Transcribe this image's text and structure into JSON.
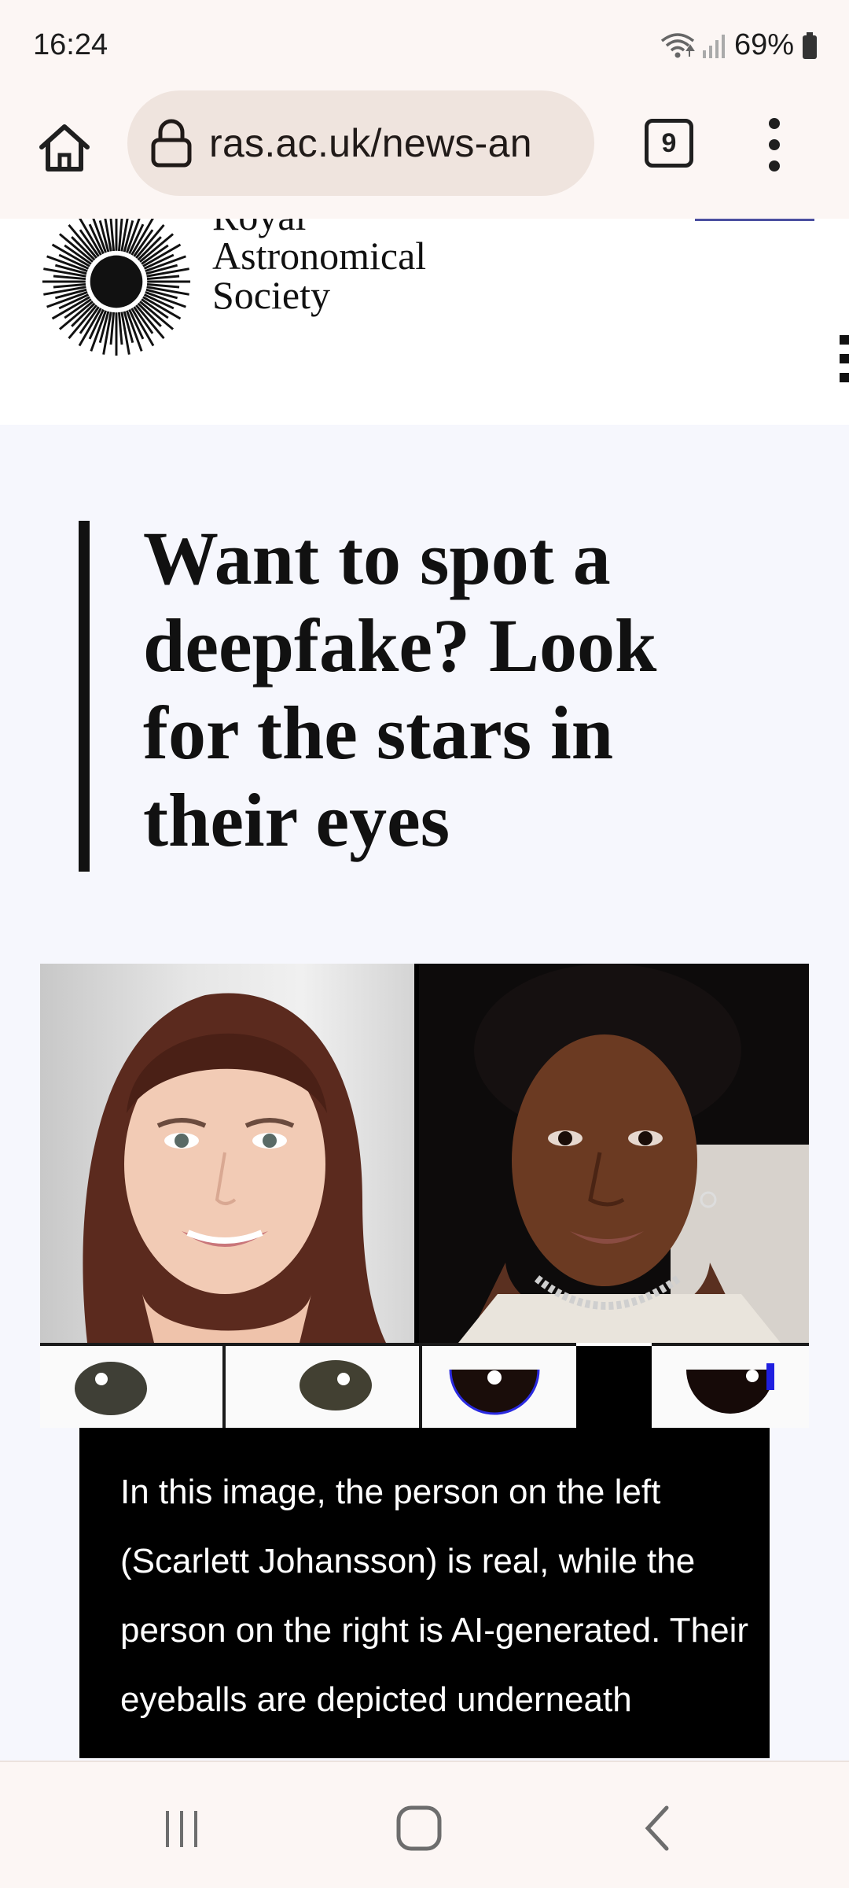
{
  "status_bar": {
    "time": "16:24",
    "battery": "69%",
    "icons": [
      "wifi-icon",
      "signal-icon",
      "battery-icon"
    ]
  },
  "browser": {
    "url": "ras.ac.uk/news-an",
    "tab_count": "9",
    "icons": [
      "home-icon",
      "lock-icon",
      "tabs-icon",
      "more-vert-icon"
    ]
  },
  "site": {
    "logo_lines": [
      "Royal",
      "Astronomical",
      "Society"
    ],
    "icons": [
      "sun-logo-icon",
      "hamburger-menu-icon"
    ]
  },
  "article": {
    "headline": "Want to spot a deepfake? Look for the stars in their eyes",
    "figure": {
      "panels": [
        "real-face-photo",
        "ai-generated-face-photo"
      ],
      "eye_crops": 4
    },
    "caption": "In this image, the person on the left (Scarlett Johansson) is real, while the person on the right is AI-generated. Their eyeballs are depicted underneath"
  },
  "nav_bar": {
    "icons": [
      "recent-apps-icon",
      "home-nav-icon",
      "back-icon"
    ]
  },
  "colors": {
    "chrome_bg": "#fcf6f4",
    "url_bar_bg": "#efe4de",
    "page_bg": "#f6f7fd",
    "caption_bg": "#000000",
    "accent_line": "#4b4fa0"
  }
}
